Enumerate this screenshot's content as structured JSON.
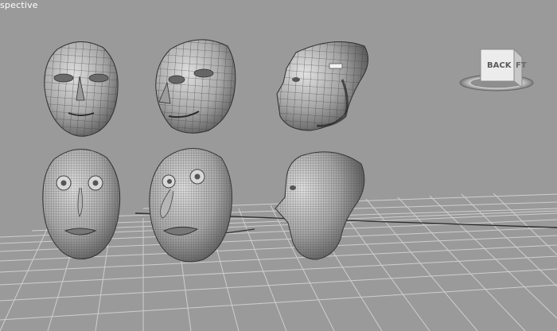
{
  "viewport": {
    "label": "spective",
    "background": "#9a9a9a",
    "grid_color": "#dcdcdc",
    "model_color": "#8c8c8c",
    "wire_color": "#3a3a3a"
  },
  "viewcube": {
    "face_label": "BACK",
    "side_label": "FT"
  },
  "models": [
    {
      "name": "low-poly-head-front"
    },
    {
      "name": "low-poly-head-three-quarter"
    },
    {
      "name": "low-poly-head-side"
    },
    {
      "name": "high-poly-head-front"
    },
    {
      "name": "high-poly-head-three-quarter"
    },
    {
      "name": "high-poly-head-side"
    }
  ]
}
